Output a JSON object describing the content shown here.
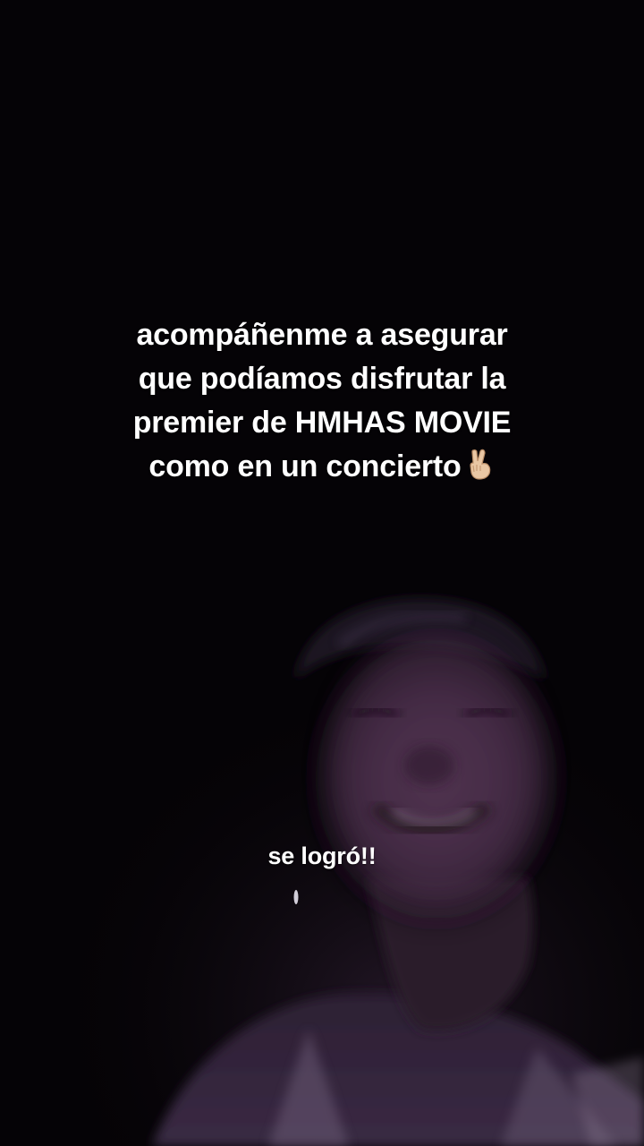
{
  "caption_main": {
    "line1": "acompáñenme a asegurar",
    "line2": "que podíamos disfrutar la",
    "line3": "premier de HMHAS MOVIE",
    "line4": "como en un concierto",
    "emoji": "victory-hand-emoji"
  },
  "caption_second": "se logró!!"
}
